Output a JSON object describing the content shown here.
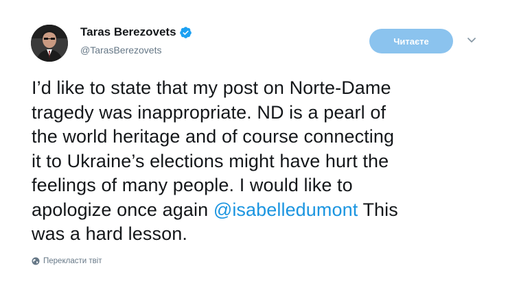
{
  "author": {
    "name": "Taras Berezovets",
    "handle": "@TarasBerezovets",
    "verified": true
  },
  "follow_button": {
    "label": "Читаєте"
  },
  "tweet": {
    "lines": [
      "I’d like to state that my post on Norte-Dame",
      "tragedy was inappropriate. ND is a pearl of",
      "the world heritage and of course connecting",
      "it to Ukraine’s elections might have hurt the",
      "feelings of many people. I would like to"
    ],
    "line6_before": "apologize once again ",
    "mention": "@isabelledumont",
    "line6_after": " This",
    "line7": "was a hard lesson."
  },
  "translate": {
    "label": "Перекласти твіт",
    "icon": "globe-icon"
  },
  "colors": {
    "link": "#1b95e0",
    "follow_button_bg": "#8bc3ee",
    "verified": "#1da1f2",
    "secondary_text": "#657786"
  }
}
